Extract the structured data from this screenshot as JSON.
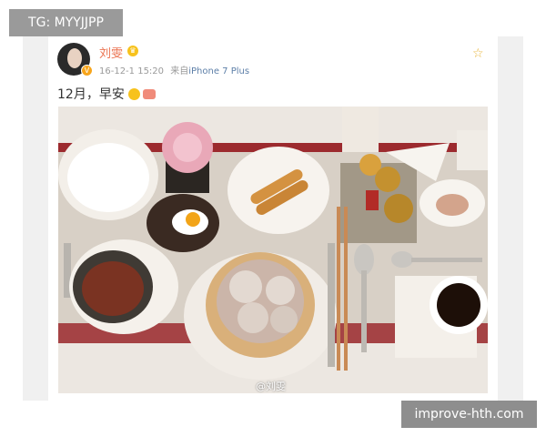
{
  "overlay": {
    "top_tag": "TG: MYYJJPP",
    "bottom_tag": "improve-hth.com"
  },
  "post": {
    "username": "刘雯",
    "timestamp": "16-12-1 15:20",
    "source_prefix": "来自",
    "source_device": "iPhone 7 Plus",
    "text": "12月，早安",
    "photo_watermark": "@刘雯"
  },
  "icons": {
    "verified": "verified-badge-icon",
    "level_badge": "crown-badge-icon",
    "favorite": "star-icon",
    "emoji_1": "smile-emoji-icon",
    "emoji_2": "cherry-emoji-icon"
  },
  "colors": {
    "username": "#eb7350",
    "device_link": "#5d7fa8",
    "star": "#e8b53a",
    "tag_background": "#9a9a9a"
  }
}
